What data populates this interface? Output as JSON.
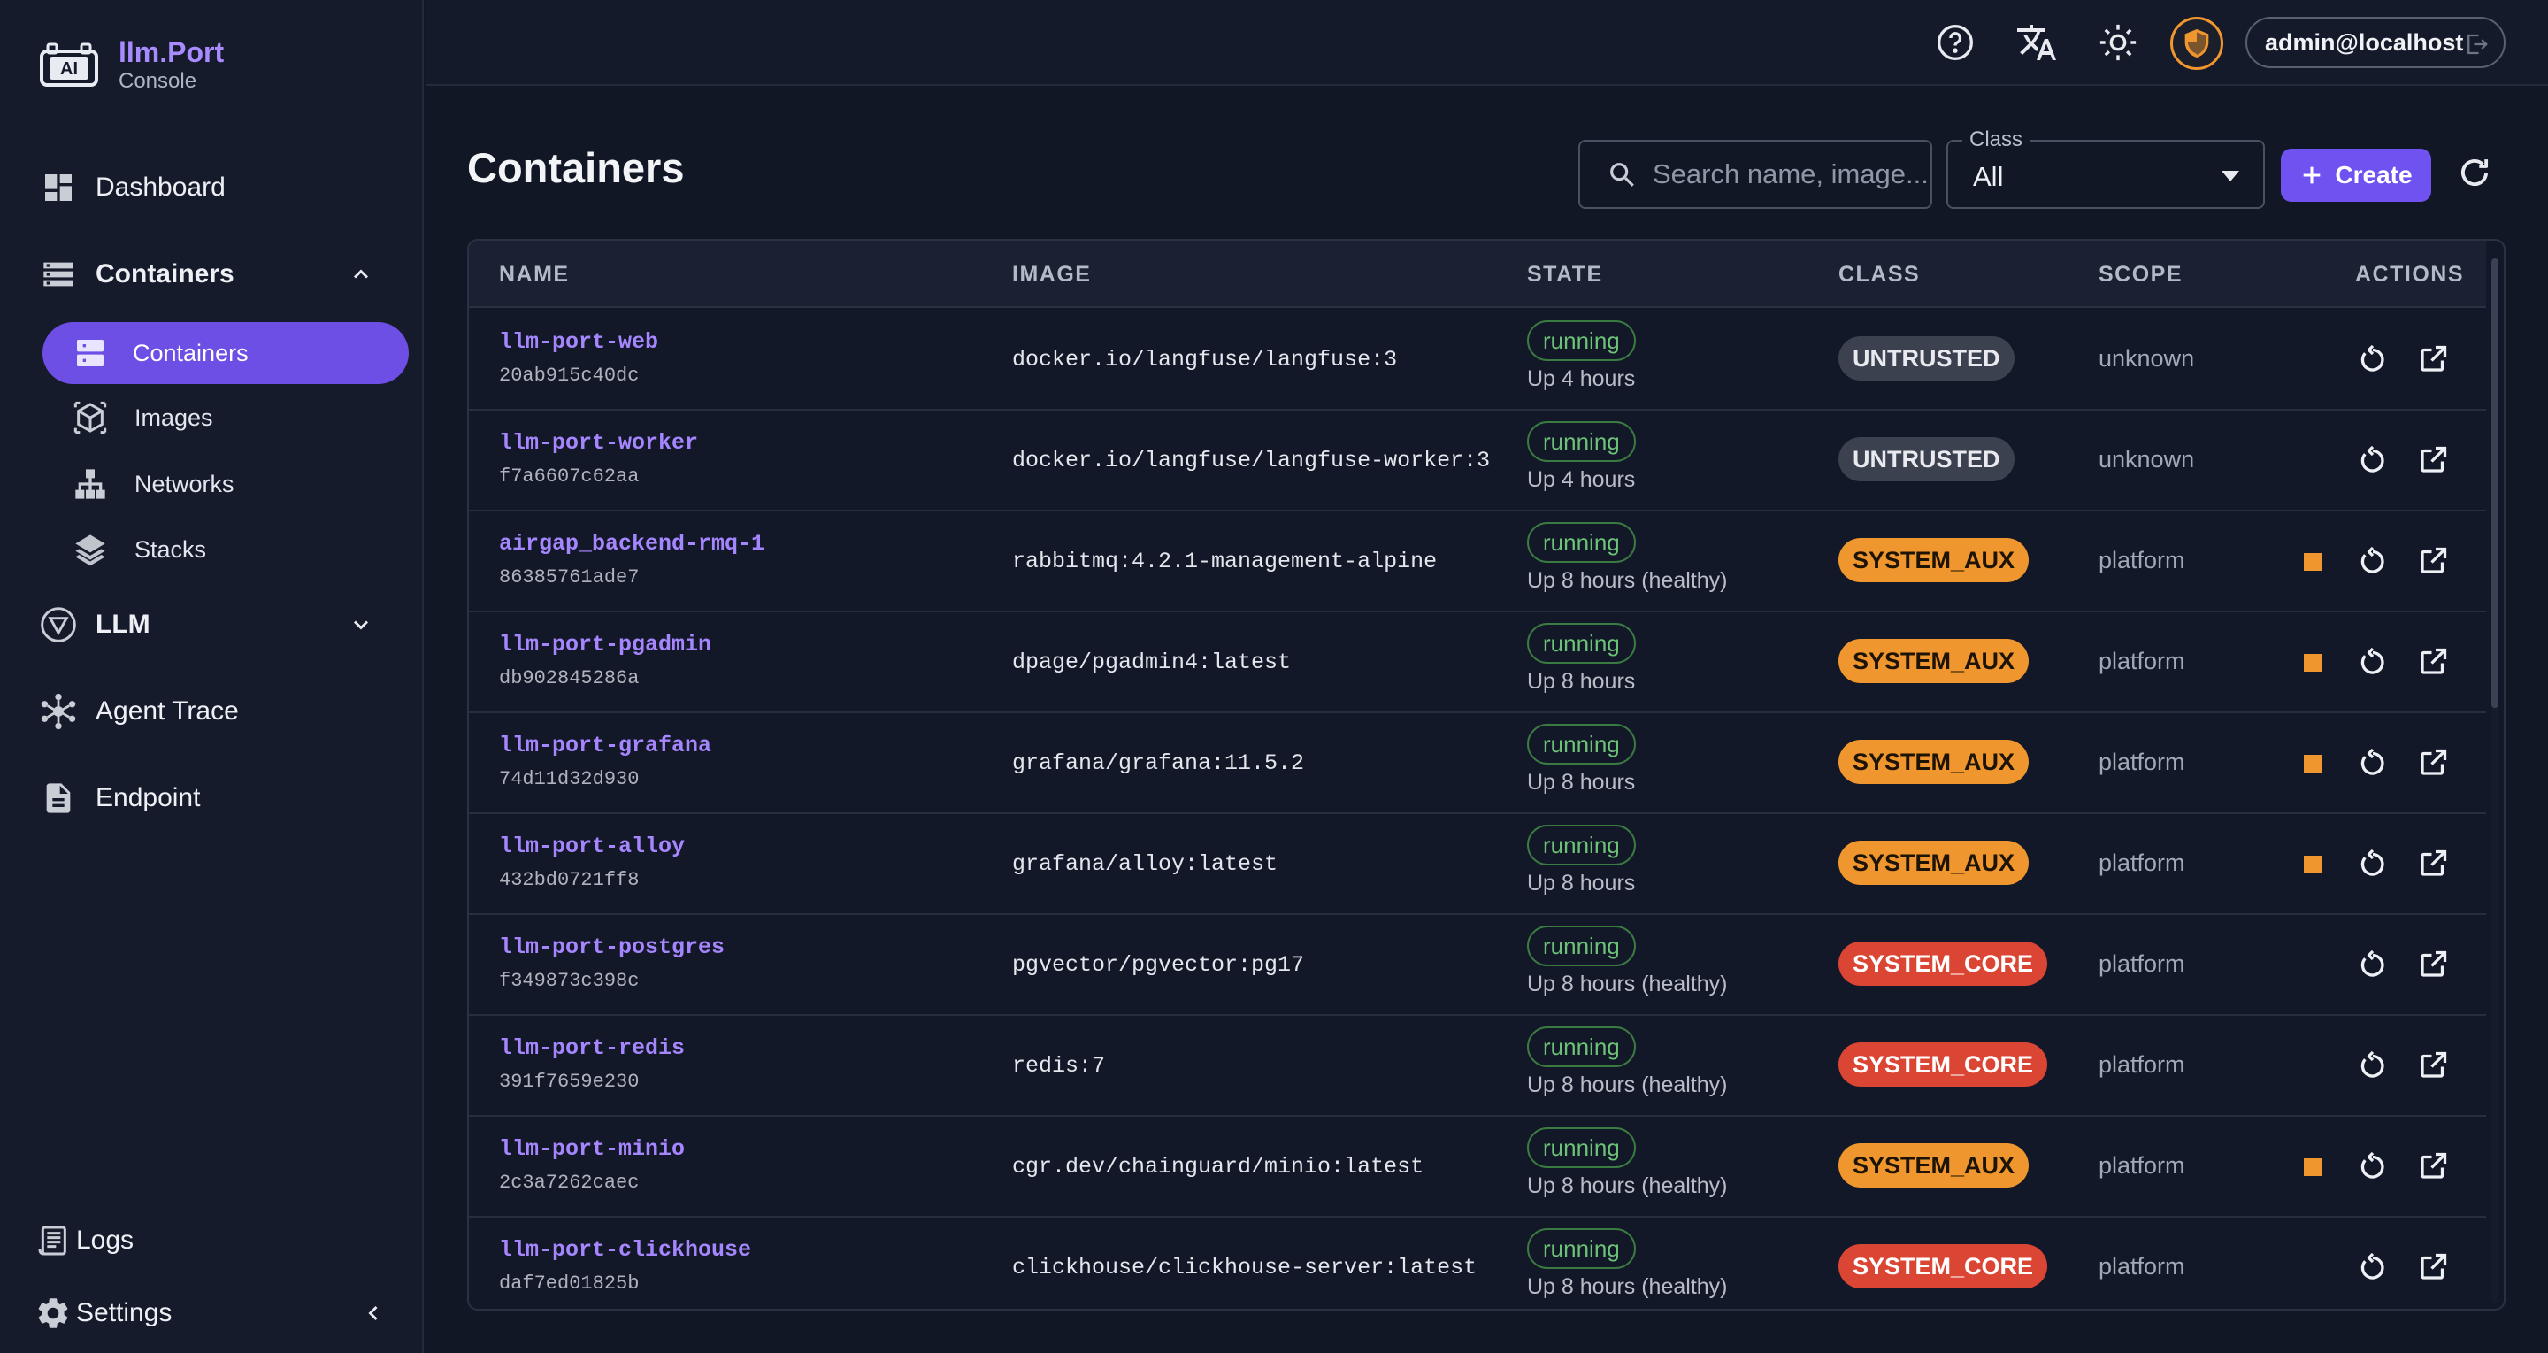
{
  "brand": {
    "name": "llm.Port",
    "subtitle": "Console",
    "logo_text": "AI"
  },
  "sidebar": {
    "items": [
      {
        "label": "Dashboard",
        "icon": "dashboard-icon"
      },
      {
        "label": "Containers",
        "icon": "storage-icon",
        "expanded": true,
        "children": [
          {
            "label": "Containers",
            "icon": "server-icon",
            "active": true
          },
          {
            "label": "Images",
            "icon": "cube-icon"
          },
          {
            "label": "Networks",
            "icon": "network-icon"
          },
          {
            "label": "Stacks",
            "icon": "layers-icon"
          }
        ]
      },
      {
        "label": "LLM",
        "icon": "llm-icon",
        "expanded": false
      },
      {
        "label": "Agent Trace",
        "icon": "hub-icon"
      },
      {
        "label": "Endpoint",
        "icon": "document-icon"
      }
    ],
    "footer": [
      {
        "label": "Logs",
        "icon": "logs-icon"
      },
      {
        "label": "Settings",
        "icon": "gear-icon"
      }
    ]
  },
  "topbar": {
    "user": "admin@localhost"
  },
  "page": {
    "title": "Containers"
  },
  "search": {
    "placeholder": "Search name, image..."
  },
  "class_filter": {
    "label": "Class",
    "value": "All"
  },
  "create_button": {
    "label": "Create"
  },
  "table": {
    "columns": [
      "NAME",
      "IMAGE",
      "STATE",
      "CLASS",
      "SCOPE",
      "ACTIONS"
    ],
    "rows": [
      {
        "name": "llm-port-web",
        "id": "20ab915c40dc",
        "image": "docker.io/langfuse/langfuse:3",
        "state": "running",
        "status": "Up 4 hours",
        "class": "UNTRUSTED",
        "scope": "unknown",
        "stoppable": false
      },
      {
        "name": "llm-port-worker",
        "id": "f7a6607c62aa",
        "image": "docker.io/langfuse/langfuse-worker:3",
        "state": "running",
        "status": "Up 4 hours",
        "class": "UNTRUSTED",
        "scope": "unknown",
        "stoppable": false
      },
      {
        "name": "airgap_backend-rmq-1",
        "id": "86385761ade7",
        "image": "rabbitmq:4.2.1-management-alpine",
        "state": "running",
        "status": "Up 8 hours (healthy)",
        "class": "SYSTEM_AUX",
        "scope": "platform",
        "stoppable": true
      },
      {
        "name": "llm-port-pgadmin",
        "id": "db902845286a",
        "image": "dpage/pgadmin4:latest",
        "state": "running",
        "status": "Up 8 hours",
        "class": "SYSTEM_AUX",
        "scope": "platform",
        "stoppable": true
      },
      {
        "name": "llm-port-grafana",
        "id": "74d11d32d930",
        "image": "grafana/grafana:11.5.2",
        "state": "running",
        "status": "Up 8 hours",
        "class": "SYSTEM_AUX",
        "scope": "platform",
        "stoppable": true
      },
      {
        "name": "llm-port-alloy",
        "id": "432bd0721ff8",
        "image": "grafana/alloy:latest",
        "state": "running",
        "status": "Up 8 hours",
        "class": "SYSTEM_AUX",
        "scope": "platform",
        "stoppable": true
      },
      {
        "name": "llm-port-postgres",
        "id": "f349873c398c",
        "image": "pgvector/pgvector:pg17",
        "state": "running",
        "status": "Up 8 hours (healthy)",
        "class": "SYSTEM_CORE",
        "scope": "platform",
        "stoppable": false
      },
      {
        "name": "llm-port-redis",
        "id": "391f7659e230",
        "image": "redis:7",
        "state": "running",
        "status": "Up 8 hours (healthy)",
        "class": "SYSTEM_CORE",
        "scope": "platform",
        "stoppable": false
      },
      {
        "name": "llm-port-minio",
        "id": "2c3a7262caec",
        "image": "cgr.dev/chainguard/minio:latest",
        "state": "running",
        "status": "Up 8 hours (healthy)",
        "class": "SYSTEM_AUX",
        "scope": "platform",
        "stoppable": true
      },
      {
        "name": "llm-port-clickhouse",
        "id": "daf7ed01825b",
        "image": "clickhouse/clickhouse-server:latest",
        "state": "running",
        "status": "Up 8 hours (healthy)",
        "class": "SYSTEM_CORE",
        "scope": "platform",
        "stoppable": false
      }
    ]
  },
  "class_colors": {
    "UNTRUSTED": {
      "bg": "#3c4150",
      "fg": "#e8eaef"
    },
    "SYSTEM_AUX": {
      "bg": "#f0962e",
      "fg": "#1d1406"
    },
    "SYSTEM_CORE": {
      "bg": "#db4534",
      "fg": "#ffffff"
    }
  },
  "colors": {
    "accent": "#7052f0",
    "brand": "#a88bff",
    "warning": "#f0962e",
    "success": "#6cc277"
  }
}
